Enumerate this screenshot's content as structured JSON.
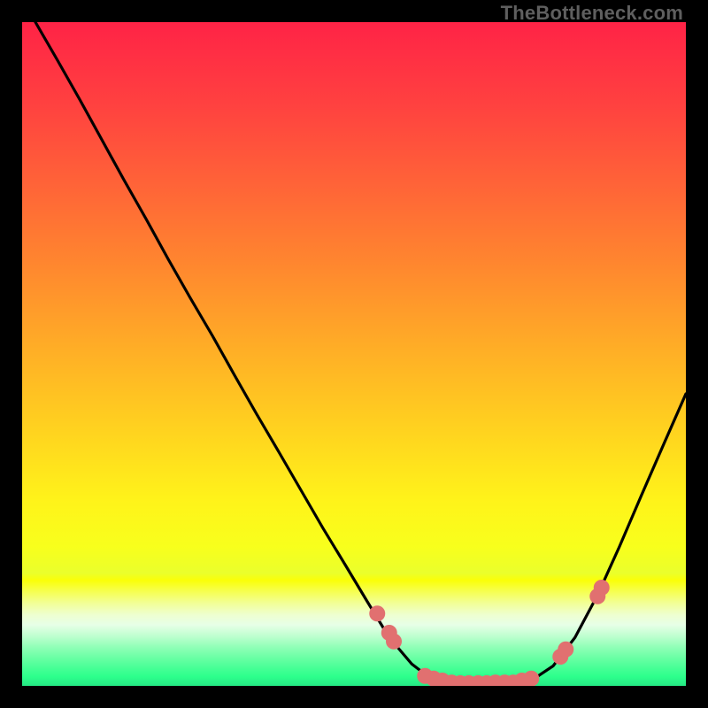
{
  "watermark": "TheBottleneck.com",
  "chart_data": {
    "type": "line",
    "title": "",
    "xlabel": "",
    "ylabel": "",
    "xlim": [
      0,
      100
    ],
    "ylim": [
      0,
      100
    ],
    "curve": {
      "name": "bottleneck-curve",
      "color": "#000000",
      "points": [
        {
          "x": 2.0,
          "y": 100.0
        },
        {
          "x": 5.3,
          "y": 94.3
        },
        {
          "x": 8.7,
          "y": 88.3
        },
        {
          "x": 12.0,
          "y": 82.3
        },
        {
          "x": 15.3,
          "y": 76.3
        },
        {
          "x": 18.7,
          "y": 70.3
        },
        {
          "x": 22.0,
          "y": 64.3
        },
        {
          "x": 25.3,
          "y": 58.5
        },
        {
          "x": 28.7,
          "y": 52.7
        },
        {
          "x": 32.0,
          "y": 46.8
        },
        {
          "x": 35.3,
          "y": 41.0
        },
        {
          "x": 38.7,
          "y": 35.2
        },
        {
          "x": 42.0,
          "y": 29.5
        },
        {
          "x": 45.3,
          "y": 23.8
        },
        {
          "x": 48.7,
          "y": 18.2
        },
        {
          "x": 52.0,
          "y": 12.7
        },
        {
          "x": 55.3,
          "y": 7.3
        },
        {
          "x": 58.7,
          "y": 3.3
        },
        {
          "x": 61.3,
          "y": 1.3
        },
        {
          "x": 64.0,
          "y": 0.3
        },
        {
          "x": 67.3,
          "y": 0.0
        },
        {
          "x": 70.7,
          "y": 0.0
        },
        {
          "x": 74.0,
          "y": 0.3
        },
        {
          "x": 77.3,
          "y": 1.2
        },
        {
          "x": 80.0,
          "y": 3.0
        },
        {
          "x": 83.3,
          "y": 7.3
        },
        {
          "x": 86.7,
          "y": 13.7
        },
        {
          "x": 90.0,
          "y": 21.0
        },
        {
          "x": 93.3,
          "y": 28.7
        },
        {
          "x": 96.7,
          "y": 36.5
        },
        {
          "x": 100.0,
          "y": 44.0
        }
      ]
    },
    "markers": {
      "name": "optimal-range-markers",
      "color": "#e17070",
      "radius": 9,
      "points": [
        {
          "x": 53.5,
          "y": 10.9
        },
        {
          "x": 55.3,
          "y": 8.0
        },
        {
          "x": 56.0,
          "y": 6.7
        },
        {
          "x": 60.7,
          "y": 1.5
        },
        {
          "x": 62.0,
          "y": 1.1
        },
        {
          "x": 63.3,
          "y": 0.8
        },
        {
          "x": 64.7,
          "y": 0.5
        },
        {
          "x": 66.0,
          "y": 0.4
        },
        {
          "x": 67.3,
          "y": 0.4
        },
        {
          "x": 68.7,
          "y": 0.4
        },
        {
          "x": 70.0,
          "y": 0.4
        },
        {
          "x": 71.3,
          "y": 0.5
        },
        {
          "x": 72.7,
          "y": 0.5
        },
        {
          "x": 74.0,
          "y": 0.5
        },
        {
          "x": 75.3,
          "y": 0.8
        },
        {
          "x": 76.7,
          "y": 1.1
        },
        {
          "x": 81.1,
          "y": 4.4
        },
        {
          "x": 81.9,
          "y": 5.5
        },
        {
          "x": 86.7,
          "y": 13.5
        },
        {
          "x": 87.3,
          "y": 14.8
        }
      ]
    },
    "background_gradient": {
      "type": "piecewise-vertical",
      "stops": [
        {
          "pos": 0.0,
          "color": "#ff2346"
        },
        {
          "pos": 0.12,
          "color": "#ff4040"
        },
        {
          "pos": 0.24,
          "color": "#ff6238"
        },
        {
          "pos": 0.36,
          "color": "#ff852f"
        },
        {
          "pos": 0.48,
          "color": "#ffaa27"
        },
        {
          "pos": 0.6,
          "color": "#ffce20"
        },
        {
          "pos": 0.72,
          "color": "#fff31a"
        },
        {
          "pos": 0.79,
          "color": "#f8ff1c"
        },
        {
          "pos": 0.83,
          "color": "#eaff2c"
        },
        {
          "pos": 0.841,
          "color": "#faff08"
        },
        {
          "pos": 0.858,
          "color": "#f6ff51"
        },
        {
          "pos": 0.875,
          "color": "#f2ff95"
        },
        {
          "pos": 0.893,
          "color": "#eeffd0"
        },
        {
          "pos": 0.908,
          "color": "#e7ffe7"
        },
        {
          "pos": 0.925,
          "color": "#beffcf"
        },
        {
          "pos": 0.941,
          "color": "#92ffb8"
        },
        {
          "pos": 0.958,
          "color": "#69ffa4"
        },
        {
          "pos": 0.974,
          "color": "#45ff95"
        },
        {
          "pos": 0.986,
          "color": "#2dff8c"
        },
        {
          "pos": 1.0,
          "color": "#25e884"
        }
      ]
    }
  }
}
